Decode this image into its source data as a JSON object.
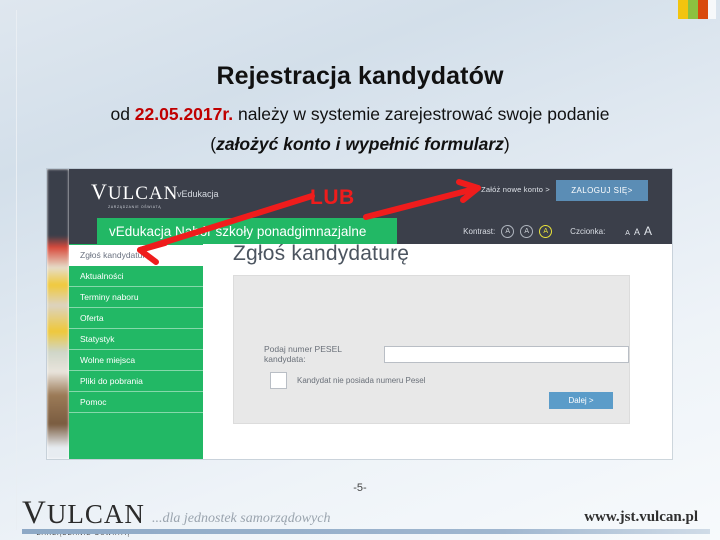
{
  "slide": {
    "title": "Rejestracja kandydatów",
    "subtitle_prefix": "od ",
    "subtitle_date": "22.05.2017r.",
    "subtitle_rest": " należy w systemie zarejestrować swoje podanie",
    "subtitle_line2_open": "(",
    "subtitle_line2": "założyć konto i wypełnić formularz",
    "subtitle_line2_close": ")",
    "page_number": "-5-"
  },
  "annotation": {
    "lub_label": "LUB",
    "color": "#ef1c1c"
  },
  "screenshot": {
    "brand": {
      "logo_v": "V",
      "logo_rest": "ULCAN",
      "logo_tagline": "ZARZĄDZANIE OŚWIATĄ",
      "product": "vEdukacja"
    },
    "account": {
      "create_label": "Załóż nowe konto >",
      "login_label": "ZALOGUJ SIĘ>"
    },
    "appbar": {
      "app_title": "vEdukacja Nabór szkoły ponadgimnazjalne",
      "contrast_label": "Kontrast:",
      "contrast_options": [
        "A",
        "A",
        "A"
      ],
      "contrast_selected_index": 2,
      "font_label": "Czcionka:",
      "font_options": [
        "A",
        "A",
        "A"
      ]
    },
    "menu": [
      {
        "label": "Zgłoś kandydaturę",
        "selected": true
      },
      {
        "label": "Aktualności",
        "selected": false
      },
      {
        "label": "Terminy naboru",
        "selected": false
      },
      {
        "label": "Oferta",
        "selected": false
      },
      {
        "label": "Statystyk",
        "selected": false
      },
      {
        "label": "Wolne miejsca",
        "selected": false
      },
      {
        "label": "Pliki do pobrania",
        "selected": false
      },
      {
        "label": "Pomoc",
        "selected": false
      }
    ],
    "form": {
      "heading": "Zgłoś kandydaturę",
      "pesel_label": "Podaj numer PESEL kandydata:",
      "pesel_value": "",
      "pesel_placeholder": "",
      "checkbox_label": "Kandydat nie posiada numeru Pesel",
      "checkbox_checked": false,
      "next_label": "Dalej >"
    }
  },
  "footer": {
    "logo_v": "V",
    "logo_rest": "ULCAN",
    "logo_tagline": "ZARZĄDZANIE OŚWIATĄ",
    "slogan": "...dla jednostek samorządowych",
    "website": "www.jst.vulcan.pl"
  },
  "decor": {
    "bar_colors": [
      "#f2c40f",
      "#8cc140",
      "#d94a0d"
    ]
  }
}
